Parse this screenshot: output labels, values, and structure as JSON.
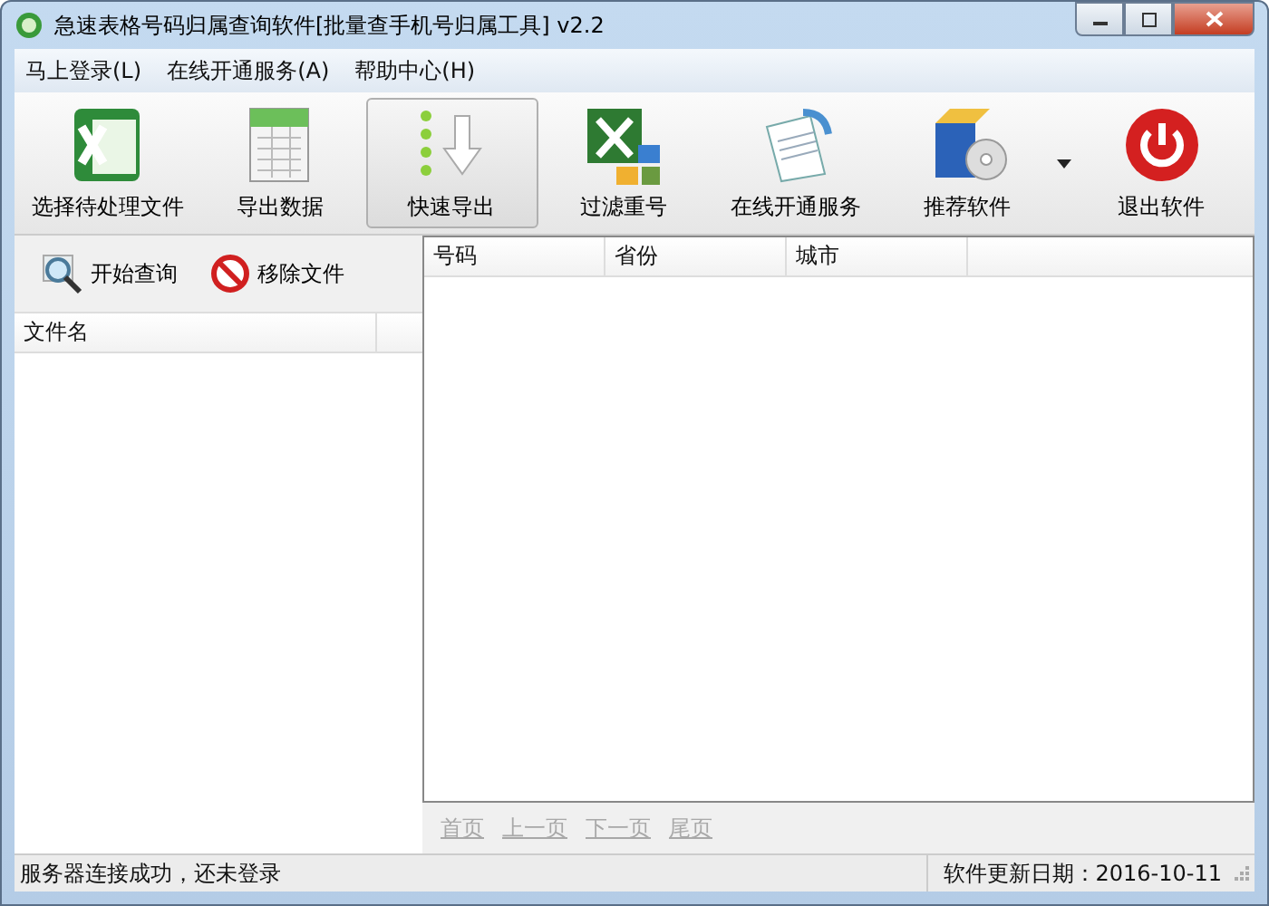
{
  "window": {
    "title": "急速表格号码归属查询软件[批量查手机号归属工具] v2.2"
  },
  "menu": [
    "马上登录(L)",
    "在线开通服务(A)",
    "帮助中心(H)"
  ],
  "toolbar": {
    "items": [
      {
        "label": "选择待处理文件",
        "kind": "excel",
        "selected": false
      },
      {
        "label": "导出数据",
        "kind": "sheet",
        "selected": false
      },
      {
        "label": "快速导出",
        "kind": "export",
        "selected": true
      },
      {
        "label": "过滤重号",
        "kind": "filter",
        "selected": false
      },
      {
        "label": "在线开通服务",
        "kind": "document",
        "selected": false
      },
      {
        "label": "推荐软件",
        "kind": "package",
        "selected": false
      },
      {
        "label": "退出软件",
        "kind": "power",
        "selected": false
      }
    ]
  },
  "left_panel": {
    "buttons": [
      {
        "label": "开始查询",
        "kind": "search"
      },
      {
        "label": "移除文件",
        "kind": "remove"
      }
    ],
    "columns": [
      "文件名"
    ]
  },
  "results": {
    "columns": [
      "号码",
      "省份",
      "城市"
    ],
    "pager": [
      {
        "label": "首页",
        "disabled": true
      },
      {
        "label": "上一页",
        "disabled": true
      },
      {
        "label": "下一页",
        "disabled": true
      },
      {
        "label": "尾页",
        "disabled": true
      }
    ]
  },
  "status_bar": {
    "message": "服务器连接成功，还未登录",
    "update_date": "软件更新日期：2016-10-11"
  }
}
